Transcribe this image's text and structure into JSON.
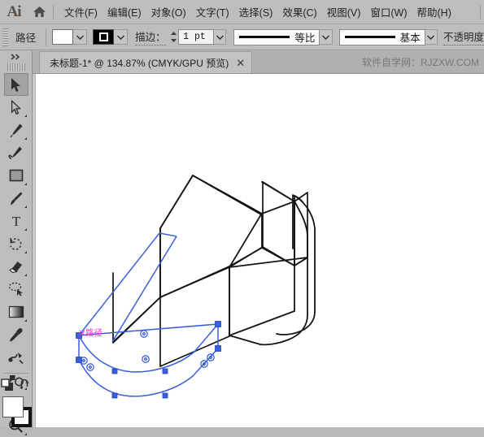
{
  "app": {
    "name": "Ai",
    "logo_label": "Ai",
    "home_icon": "home-icon"
  },
  "menubar": {
    "items": [
      {
        "label": "文件(F)",
        "name": "menu-file"
      },
      {
        "label": "编辑(E)",
        "name": "menu-edit"
      },
      {
        "label": "对象(O)",
        "name": "menu-object"
      },
      {
        "label": "文字(T)",
        "name": "menu-type"
      },
      {
        "label": "选择(S)",
        "name": "menu-select"
      },
      {
        "label": "效果(C)",
        "name": "menu-effect"
      },
      {
        "label": "视图(V)",
        "name": "menu-view"
      },
      {
        "label": "窗口(W)",
        "name": "menu-window"
      },
      {
        "label": "帮助(H)",
        "name": "menu-help"
      }
    ]
  },
  "controlbar": {
    "selection_label": "路径",
    "fill_swatch": {
      "name": "fill-swatch",
      "color": "#ffffff"
    },
    "stroke_swatch": {
      "name": "stroke-swatch",
      "color": "#000000"
    },
    "stroke_label": "描边：",
    "stroke_weight": "1 pt",
    "stroke_profile": "等比",
    "brush_definition": "基本",
    "opacity_label": "不透明度"
  },
  "toolbar": {
    "collapse_icon": "double-chevron-right-icon",
    "tools": [
      {
        "name": "tool-selection",
        "icon": "selection-arrow-icon",
        "active": true,
        "flyout": false
      },
      {
        "name": "tool-direct-selection",
        "icon": "direct-selection-arrow-icon",
        "active": false,
        "flyout": true
      },
      {
        "name": "tool-pen",
        "icon": "pen-icon",
        "active": false,
        "flyout": true
      },
      {
        "name": "tool-curvature",
        "icon": "curvature-pen-icon",
        "active": false,
        "flyout": false
      },
      {
        "name": "tool-rectangle",
        "icon": "rectangle-icon",
        "active": false,
        "flyout": true
      },
      {
        "name": "tool-paintbrush",
        "icon": "paintbrush-icon",
        "active": false,
        "flyout": true
      },
      {
        "name": "tool-type",
        "icon": "type-t-icon",
        "active": false,
        "flyout": true
      },
      {
        "name": "tool-rotate",
        "icon": "rotate-icon",
        "active": false,
        "flyout": true
      },
      {
        "name": "tool-eraser",
        "icon": "eraser-icon",
        "active": false,
        "flyout": true
      },
      {
        "name": "tool-lasso",
        "icon": "lasso-select-icon",
        "active": false,
        "flyout": false
      },
      {
        "name": "tool-gradient",
        "icon": "gradient-icon",
        "active": false,
        "flyout": true
      },
      {
        "name": "tool-eyedropper",
        "icon": "eyedropper-icon",
        "active": false,
        "flyout": false
      },
      {
        "name": "tool-blend",
        "icon": "blend-icon",
        "active": false,
        "flyout": false
      },
      {
        "name": "tool-symbol-sprayer",
        "icon": "symbol-sprayer-icon",
        "active": false,
        "flyout": true
      },
      {
        "name": "tool-artboard",
        "icon": "artboard-icon",
        "active": false,
        "flyout": false
      },
      {
        "name": "tool-zoom",
        "icon": "magnifier-icon",
        "active": false,
        "flyout": true
      }
    ],
    "default_fill_stroke_icon": "default-fill-stroke-icon",
    "swap_fill_stroke_icon": "swap-fill-stroke-icon",
    "fill_color": "#ffffff",
    "stroke_color": "#111111"
  },
  "document": {
    "tab_title": "未标题-1* @ 134.87% (CMYK/GPU 预览)",
    "close_glyph": "✕",
    "zoom_percent": "134.87%",
    "color_mode": "CMYK/GPU 预览",
    "watermark": "软件自学网：RJZXW.COM"
  },
  "canvas": {
    "smart_guide_label": "路径",
    "smart_guide_color": "#ff2fd0",
    "selection_color": "#3a5fdd",
    "artwork_stroke_color": "#141414",
    "artwork_name": "isometric-bracket-drawing"
  }
}
